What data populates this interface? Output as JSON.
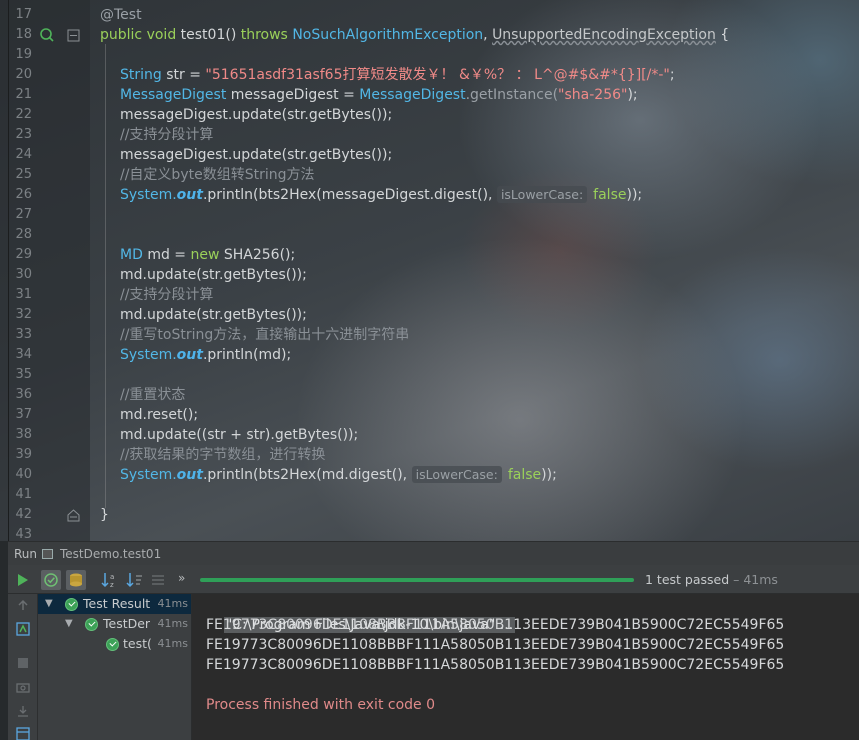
{
  "editor": {
    "lines": [
      {
        "n": "17",
        "segments": [
          {
            "t": "@Test",
            "c": "ann"
          }
        ]
      },
      {
        "n": "18",
        "segments": [
          {
            "t": "public",
            "c": "kw"
          },
          {
            "t": " void ",
            "c": "kw"
          },
          {
            "t": "test01() ",
            "c": ""
          },
          {
            "t": "throws ",
            "c": "kw"
          },
          {
            "t": "NoSuchAlgorithmException",
            "c": "type"
          },
          {
            "t": ", ",
            "c": ""
          },
          {
            "t": "UnsupportedEncodingException",
            "c": "warn"
          },
          {
            "t": " {",
            "c": ""
          }
        ]
      },
      {
        "n": "19",
        "segments": []
      },
      {
        "n": "20",
        "segments": [
          {
            "t": "String ",
            "c": "type"
          },
          {
            "t": "str = ",
            "c": ""
          },
          {
            "t": "\"51651asdf31asf65打算短发散发￥！ &￥%？ ： L^@#$&#*{}][/*-\"",
            "c": "str"
          },
          {
            "t": ";",
            "c": ""
          }
        ]
      },
      {
        "n": "21",
        "segments": [
          {
            "t": "MessageDigest ",
            "c": "type"
          },
          {
            "t": "messageDigest = ",
            "c": ""
          },
          {
            "t": "MessageDigest",
            "c": "type"
          },
          {
            "t": ".getInstance(",
            "c": "ann"
          },
          {
            "t": "\"sha-256\"",
            "c": "str"
          },
          {
            "t": ");",
            "c": ""
          }
        ]
      },
      {
        "n": "22",
        "segments": [
          {
            "t": "messageDigest.update(str.getBytes());",
            "c": ""
          }
        ]
      },
      {
        "n": "23",
        "segments": [
          {
            "t": "//支持分段计算",
            "c": "cm"
          }
        ]
      },
      {
        "n": "24",
        "segments": [
          {
            "t": "messageDigest.update(str.getBytes());",
            "c": ""
          }
        ]
      },
      {
        "n": "25",
        "segments": [
          {
            "t": "//自定义byte数组转String方法",
            "c": "cm"
          }
        ]
      },
      {
        "n": "26",
        "segments": [
          {
            "t": "System.",
            "c": "type"
          },
          {
            "t": "out",
            "c": "fld"
          },
          {
            "t": ".println(bts2Hex(messageDigest.digest(), ",
            "c": ""
          },
          {
            "t": "isLowerCase:",
            "c": "hint"
          },
          {
            "t": "false",
            "c": "kw"
          },
          {
            "t": "));",
            "c": ""
          }
        ]
      },
      {
        "n": "27",
        "segments": []
      },
      {
        "n": "28",
        "segments": []
      },
      {
        "n": "29",
        "segments": [
          {
            "t": "MD ",
            "c": "type"
          },
          {
            "t": "md = ",
            "c": ""
          },
          {
            "t": "new ",
            "c": "kw"
          },
          {
            "t": "SHA256();",
            "c": ""
          }
        ]
      },
      {
        "n": "30",
        "segments": [
          {
            "t": "md.update(str.getBytes());",
            "c": ""
          }
        ]
      },
      {
        "n": "31",
        "segments": [
          {
            "t": "//支持分段计算",
            "c": "cm"
          }
        ]
      },
      {
        "n": "32",
        "segments": [
          {
            "t": "md.update(str.getBytes());",
            "c": ""
          }
        ]
      },
      {
        "n": "33",
        "segments": [
          {
            "t": "//重写toString方法，直接输出十六进制字符串",
            "c": "cm"
          }
        ]
      },
      {
        "n": "34",
        "segments": [
          {
            "t": "System.",
            "c": "type"
          },
          {
            "t": "out",
            "c": "fld"
          },
          {
            "t": ".println(md);",
            "c": ""
          }
        ]
      },
      {
        "n": "35",
        "segments": []
      },
      {
        "n": "36",
        "segments": [
          {
            "t": "//重置状态",
            "c": "cm"
          }
        ]
      },
      {
        "n": "37",
        "segments": [
          {
            "t": "md.reset();",
            "c": ""
          }
        ]
      },
      {
        "n": "38",
        "segments": [
          {
            "t": "md.update((str + str).getBytes());",
            "c": ""
          }
        ]
      },
      {
        "n": "39",
        "segments": [
          {
            "t": "//获取结果的字节数组，进行转换",
            "c": "cm"
          }
        ]
      },
      {
        "n": "40",
        "segments": [
          {
            "t": "System.",
            "c": "type"
          },
          {
            "t": "out",
            "c": "fld"
          },
          {
            "t": ".println(bts2Hex(md.digest(), ",
            "c": ""
          },
          {
            "t": "isLowerCase:",
            "c": "hint"
          },
          {
            "t": "false",
            "c": "kw"
          },
          {
            "t": "));",
            "c": ""
          }
        ]
      },
      {
        "n": "41",
        "segments": []
      },
      {
        "n": "42",
        "segments": [
          {
            "t": "}",
            "c": ""
          }
        ]
      },
      {
        "n": "43",
        "segments": []
      }
    ]
  },
  "run": {
    "label": "Run",
    "tab": "TestDemo.test01",
    "status": "1 test passed",
    "duration": " – 41ms",
    "tree": [
      {
        "label": "Test Result",
        "time": "41ms"
      },
      {
        "label": "TestDer",
        "time": "41ms"
      },
      {
        "label": "test(",
        "time": "41ms"
      }
    ],
    "console": {
      "command": "\"C:\\Program Files\\Java\\jdk-10\\bin\\java\" ...",
      "outputs": [
        "FE19773C80096DE1108BBBF111A58050B113EEDE739B041B5900C72EC5549F65",
        "FE19773C80096DE1108BBBF111A58050B113EEDE739B041B5900C72EC5549F65",
        "FE19773C80096DE1108BBBF111A58050B113EEDE739B041B5900C72EC5549F65"
      ],
      "exit": "Process finished with exit code 0"
    }
  },
  "colors": {
    "keyword": "#9ad05a",
    "type": "#52b7e6",
    "string": "#f08a88",
    "progress": "#2f9f58"
  }
}
